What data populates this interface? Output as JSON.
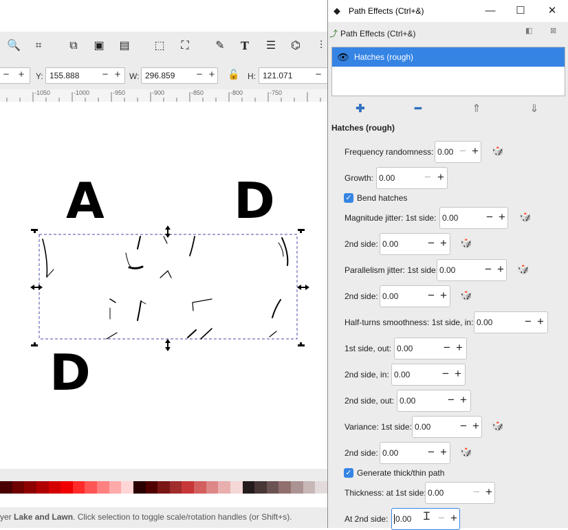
{
  "toolbar": {
    "icons": [
      "zoom-drawing-icon",
      "zoom-page-icon",
      "duplicate-icon",
      "clone-icon",
      "unlink-clone-icon",
      "select-same-icon",
      "transform-icon",
      "node-editor-icon",
      "text-tool-icon",
      "layers-icon",
      "xml-editor-icon",
      "align-icon"
    ]
  },
  "coords": {
    "y_label": "Y:",
    "y_value": "155.888",
    "w_label": "W:",
    "w_value": "296.859",
    "h_label": "H:",
    "h_value": "121.071"
  },
  "ruler": {
    "ticks": [
      "-1050",
      "-1000",
      "-950",
      "-900",
      "-850",
      "-800",
      "-750"
    ]
  },
  "canvas": {
    "letters": [
      {
        "text": "A"
      },
      {
        "text": "D"
      },
      {
        "text": "D"
      }
    ]
  },
  "palette_colors": [
    "#4a0000",
    "#6e0000",
    "#8e0000",
    "#b00000",
    "#d40000",
    "#f00000",
    "#ff2a2a",
    "#ff5555",
    "#ff8080",
    "#ffaaaa",
    "#ffd5d5",
    "#2b0000",
    "#500000",
    "#7a1616",
    "#a02c2c",
    "#c83737",
    "#d35f5f",
    "#de8787",
    "#e9afaf",
    "#f4d7d7",
    "#241c1c",
    "#483737",
    "#6c5353",
    "#916f6f",
    "#ac9393",
    "#c8b7b7",
    "#e3dbdb"
  ],
  "status": {
    "prefix": "yer ",
    "layer_name": "Lake and Lawn",
    "message": ". Click selection to toggle scale/rotation handles (or Shift+s)."
  },
  "dialog": {
    "window_title": "Path Effects (Ctrl+&)",
    "dock_title": "Path Effects (Ctrl+&)",
    "effect_name": "Hatches (rough)",
    "section_title": "Hatches (rough)",
    "params": [
      {
        "label": "Frequency randomness:",
        "value": "0.00",
        "dice": true
      },
      {
        "label": "Growth:",
        "value": "0.00",
        "dice": false
      },
      {
        "label": "Bend hatches",
        "checkbox": true
      },
      {
        "label": "Magnitude jitter: 1st side:",
        "value": "0.00",
        "dice": true
      },
      {
        "label": "2nd side:",
        "value": "0.00",
        "dice": true
      },
      {
        "label": "Parallelism jitter: 1st side:",
        "value": "0.00",
        "dice": true
      },
      {
        "label": "2nd side:",
        "value": "0.00",
        "dice": true
      },
      {
        "label": "Half-turns smoothness: 1st side, in:",
        "value": "0.00",
        "dice": false
      },
      {
        "label": "1st side, out:",
        "value": "0.00",
        "dice": false
      },
      {
        "label": "2nd side, in:",
        "value": "0.00",
        "dice": false
      },
      {
        "label": "2nd side, out:",
        "value": "0.00",
        "dice": false
      },
      {
        "label": "Variance: 1st side:",
        "value": "0.00",
        "dice": true
      },
      {
        "label": "2nd side:",
        "value": "0.00",
        "dice": true
      },
      {
        "label": "Generate thick/thin path",
        "checkbox": true
      },
      {
        "label": "Thickness: at 1st side:",
        "value": "0.00",
        "dice": false
      },
      {
        "label": "At 2nd side:",
        "value": "0.00",
        "dice": false
      }
    ]
  }
}
